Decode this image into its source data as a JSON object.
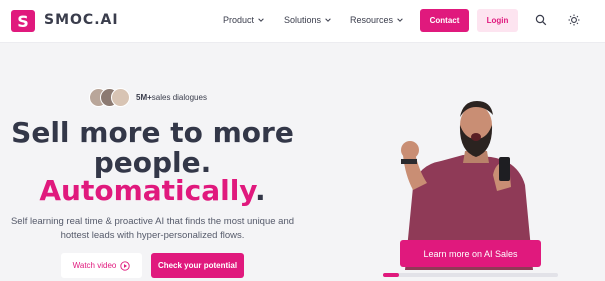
{
  "header": {
    "logo_letter": "S",
    "logo_text": "SMOC.AI",
    "nav": [
      {
        "label": "Product",
        "icon": "chevron-down-icon"
      },
      {
        "label": "Solutions",
        "icon": "chevron-down-icon"
      },
      {
        "label": "Resources",
        "icon": "chevron-down-icon"
      }
    ],
    "contact_label": "Contact",
    "login_label": "Login",
    "search_icon": "search-icon",
    "theme_icon": "sun-icon"
  },
  "hero": {
    "badge_count": "5M+",
    "badge_text": "sales dialogues",
    "headline_line1": "Sell more to more",
    "headline_line2": "people.",
    "headline_line3": "Automatically",
    "headline_period": ".",
    "sub_line1": "Self learning real time & proactive AI that finds the most unique and",
    "sub_line2": "hottest leads with hyper-personalized flows.",
    "watch_label": "Watch video",
    "watch_icon": "play-circle-icon",
    "check_label": "Check your potential"
  },
  "slider": {
    "learn_label": "Learn more on AI Sales",
    "progress": 0.09
  },
  "colors": {
    "accent": "#e0197d",
    "accent_light": "#fde4f0",
    "text_dark": "#333748",
    "background": "#f4f4f6"
  }
}
